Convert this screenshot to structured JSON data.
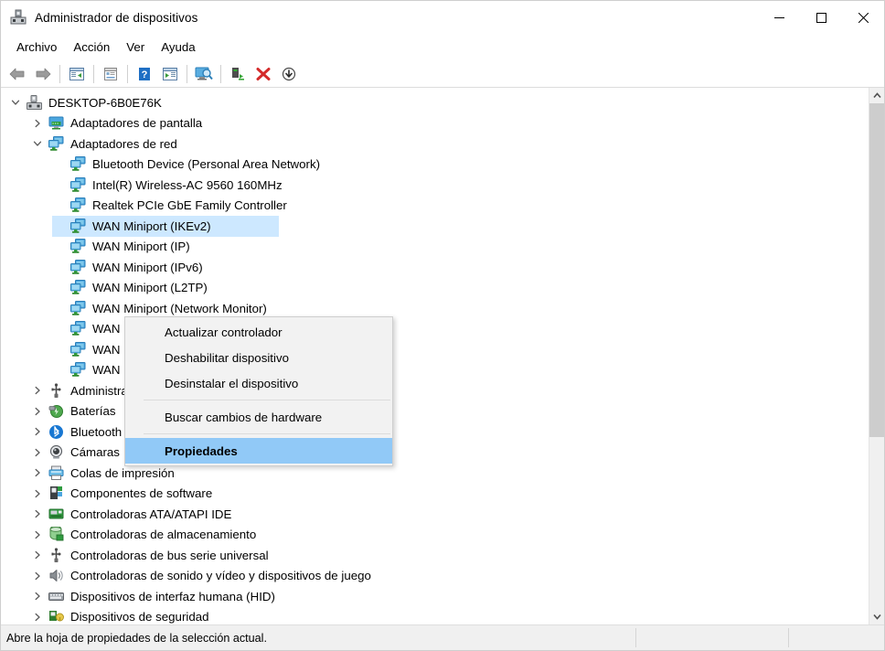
{
  "window": {
    "title": "Administrador de dispositivos",
    "icon": "device-manager-icon",
    "controls": {
      "minimize": "—",
      "maximize": "□",
      "close": "✕"
    }
  },
  "menubar": {
    "items": [
      {
        "label": "Archivo",
        "name": "menu-archivo"
      },
      {
        "label": "Acción",
        "name": "menu-accion"
      },
      {
        "label": "Ver",
        "name": "menu-ver"
      },
      {
        "label": "Ayuda",
        "name": "menu-ayuda"
      }
    ]
  },
  "toolbar": {
    "buttons": [
      {
        "name": "back-button",
        "icon": "back-arrow-icon"
      },
      {
        "name": "forward-button",
        "icon": "forward-arrow-icon"
      },
      {
        "name": "show-hide-console-tree-button",
        "icon": "console-tree-icon"
      },
      {
        "name": "properties-button",
        "icon": "properties-page-icon"
      },
      {
        "name": "help-button",
        "icon": "question-mark-icon"
      },
      {
        "name": "show-hide-action-pane-button",
        "icon": "action-pane-icon"
      },
      {
        "name": "scan-hardware-changes-button",
        "icon": "monitor-search-icon"
      },
      {
        "name": "update-driver-button",
        "icon": "update-driver-icon"
      },
      {
        "name": "uninstall-device-button",
        "icon": "red-x-icon"
      },
      {
        "name": "disable-device-button",
        "icon": "down-arrow-circle-icon"
      }
    ]
  },
  "tree": {
    "nodes": [
      {
        "label": "DESKTOP-6B0E76K",
        "depth": 0,
        "expander": "expanded",
        "icon": "computer-icon",
        "selected": false
      },
      {
        "label": "Adaptadores de pantalla",
        "depth": 1,
        "expander": "collapsed",
        "icon": "display-adapter-icon",
        "selected": false
      },
      {
        "label": "Adaptadores de red",
        "depth": 1,
        "expander": "expanded",
        "icon": "network-adapter-icon",
        "selected": false
      },
      {
        "label": "Bluetooth Device (Personal Area Network)",
        "depth": 2,
        "expander": "none",
        "icon": "network-adapter-icon",
        "selected": false
      },
      {
        "label": "Intel(R) Wireless-AC 9560 160MHz",
        "depth": 2,
        "expander": "none",
        "icon": "network-adapter-icon",
        "selected": false
      },
      {
        "label": "Realtek PCIe GbE Family Controller",
        "depth": 2,
        "expander": "none",
        "icon": "network-adapter-icon",
        "selected": false
      },
      {
        "label": "WAN Miniport (IKEv2)",
        "depth": 2,
        "expander": "none",
        "icon": "network-adapter-icon",
        "selected": true
      },
      {
        "label": "WAN Miniport (IP)",
        "depth": 2,
        "expander": "none",
        "icon": "network-adapter-icon",
        "selected": false
      },
      {
        "label": "WAN Miniport (IPv6)",
        "depth": 2,
        "expander": "none",
        "icon": "network-adapter-icon",
        "selected": false
      },
      {
        "label": "WAN Miniport (L2TP)",
        "depth": 2,
        "expander": "none",
        "icon": "network-adapter-icon",
        "selected": false
      },
      {
        "label": "WAN Miniport (Network Monitor)",
        "depth": 2,
        "expander": "none",
        "icon": "network-adapter-icon",
        "selected": false
      },
      {
        "label": "WAN Miniport (PPPOE)",
        "depth": 2,
        "expander": "none",
        "icon": "network-adapter-icon",
        "selected": false
      },
      {
        "label": "WAN Miniport (PPTP)",
        "depth": 2,
        "expander": "none",
        "icon": "network-adapter-icon",
        "selected": false
      },
      {
        "label": "WAN Miniport (SSTP)",
        "depth": 2,
        "expander": "none",
        "icon": "network-adapter-icon",
        "selected": false
      },
      {
        "label": "Administradores de conector USB",
        "depth": 1,
        "expander": "collapsed",
        "icon": "usb-connector-icon",
        "selected": false
      },
      {
        "label": "Baterías",
        "depth": 1,
        "expander": "collapsed",
        "icon": "battery-icon",
        "selected": false
      },
      {
        "label": "Bluetooth",
        "depth": 1,
        "expander": "collapsed",
        "icon": "bluetooth-icon",
        "selected": false
      },
      {
        "label": "Cámaras",
        "depth": 1,
        "expander": "collapsed",
        "icon": "camera-icon",
        "selected": false
      },
      {
        "label": "Colas de impresión",
        "depth": 1,
        "expander": "collapsed",
        "icon": "printer-icon",
        "selected": false
      },
      {
        "label": "Componentes de software",
        "depth": 1,
        "expander": "collapsed",
        "icon": "software-component-icon",
        "selected": false
      },
      {
        "label": "Controladoras ATA/ATAPI IDE",
        "depth": 1,
        "expander": "collapsed",
        "icon": "ide-controller-icon",
        "selected": false
      },
      {
        "label": "Controladoras de almacenamiento",
        "depth": 1,
        "expander": "collapsed",
        "icon": "storage-controller-icon",
        "selected": false
      },
      {
        "label": "Controladoras de bus serie universal",
        "depth": 1,
        "expander": "collapsed",
        "icon": "usb-controller-icon",
        "selected": false
      },
      {
        "label": "Controladoras de sonido y vídeo y dispositivos de juego",
        "depth": 1,
        "expander": "collapsed",
        "icon": "speaker-icon",
        "selected": false
      },
      {
        "label": "Dispositivos de interfaz humana (HID)",
        "depth": 1,
        "expander": "collapsed",
        "icon": "hid-icon",
        "selected": false
      },
      {
        "label": "Dispositivos de seguridad",
        "depth": 1,
        "expander": "collapsed",
        "icon": "security-device-icon",
        "selected": false
      }
    ]
  },
  "context_menu": {
    "items": [
      {
        "label": "Actualizar controlador",
        "name": "ctx-update-driver",
        "highlighted": false,
        "separator_after": false
      },
      {
        "label": "Deshabilitar dispositivo",
        "name": "ctx-disable-device",
        "highlighted": false,
        "separator_after": false
      },
      {
        "label": "Desinstalar el dispositivo",
        "name": "ctx-uninstall-device",
        "highlighted": false,
        "separator_after": true
      },
      {
        "label": "Buscar cambios de hardware",
        "name": "ctx-scan-hardware-changes",
        "highlighted": false,
        "separator_after": true
      },
      {
        "label": "Propiedades",
        "name": "ctx-properties",
        "highlighted": true,
        "separator_after": false
      }
    ]
  },
  "statusbar": {
    "text": "Abre la hoja de propiedades de la selección actual."
  },
  "colors": {
    "selection": "#cde8ff",
    "menu_highlight": "#91c9f7",
    "menu_bg": "#f2f2f2",
    "statusbar_bg": "#f0f0f0"
  }
}
